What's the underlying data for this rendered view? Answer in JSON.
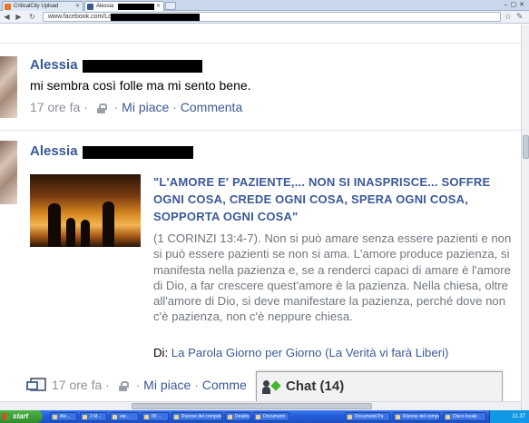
{
  "browser": {
    "tabs": [
      {
        "title": "CriticalCity Upload",
        "favicon_color": "#e8742a",
        "active": false
      },
      {
        "title": "Alessia",
        "favicon_color": "#3b5998",
        "active": true
      }
    ],
    "address": "www.facebook.com/LoS"
  },
  "feed": {
    "post1": {
      "author": "Alessia",
      "text": "mi sembra così folle ma mi sento bene.",
      "time": "17 ore fa",
      "separator": " · ",
      "like": "Mi piace",
      "comment": "Commenta"
    },
    "post2": {
      "author": "Alessia",
      "attachment": {
        "title": "\"L'AMORE E' PAZIENTE,... NON SI INASPRISCE... SOFFRE OGNI COSA, CREDE OGNI COSA, SPERA OGNI COSA, SOPPORTA OGNI COSA\"",
        "body": "(1 CORINZI 13:4-7).   Non si può amare senza essere pazienti e non si può essere pazienti se non si ama. L'amore produce pazienza, si manifesta nella pazienza e, se a renderci capaci di amare è l'amore di Dio, a far crescere quest'amore è la pazienza. Nella chiesa, oltre all'amore di Dio, si deve manifestare la  pazienza, perché dove non c'è pazienza, non c'è  neppure chiesa.",
        "source_prefix": "Di: ",
        "source": "La Parola Giorno per Giorno (La Verità vi farà Liberi)"
      },
      "time": "17 ore fa",
      "separator": " · ",
      "like": "Mi piace",
      "comment": "Comme"
    }
  },
  "chat": {
    "label": "Chat",
    "count": "(14)"
  },
  "taskbar": {
    "start": "start",
    "tasks": [
      "Ale...",
      "2 M...",
      "var...",
      "00 ...",
      "Risorse del computer",
      "Desktop",
      "Documenti",
      "Documenti Pa",
      "Risorse del computer",
      "Disco locale"
    ],
    "clock": "11.37"
  },
  "colors": {
    "fb_link": "#3b5998",
    "meta_grey": "#8a8f99",
    "body_grey": "#707680",
    "taskbar_blue": "#245edb",
    "start_green": "#3c9a36"
  }
}
